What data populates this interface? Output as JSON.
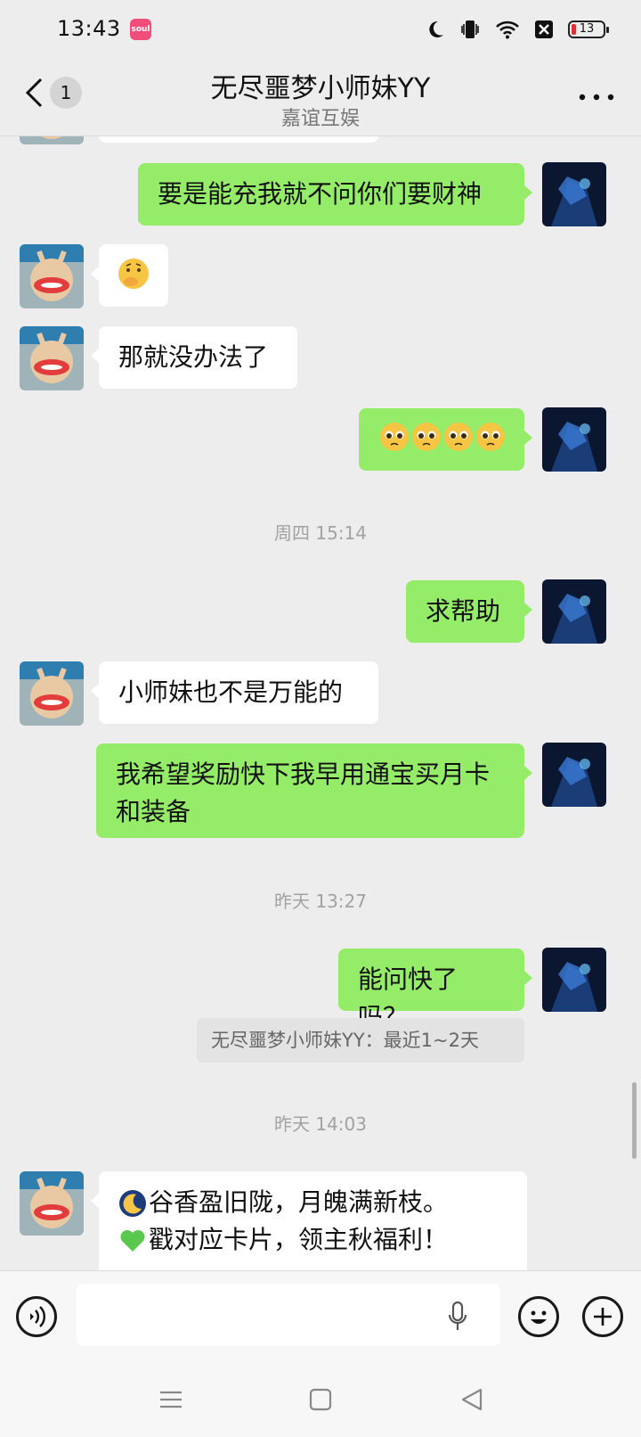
{
  "status_bar": {
    "time": "13:43",
    "app_icon": "soul-app-icon",
    "icons": [
      "moon-icon",
      "vibrate-icon",
      "wifi-icon",
      "close-box-icon",
      "battery-icon"
    ],
    "battery_level": "13",
    "battery_color": "#e0302f"
  },
  "header": {
    "back_icon": "chevron-left-icon",
    "unread_count": "1",
    "title": "无尽噩梦小师妹YY",
    "subtitle": "嘉谊互娱",
    "more_icon": "more-dots-icon"
  },
  "messages": [
    {
      "side": "out",
      "text": "要是能充我就不问你们要财神"
    },
    {
      "side": "in",
      "emoji": "thinking-face-emoji"
    },
    {
      "side": "in",
      "text": "那就没办法了"
    },
    {
      "side": "out",
      "emoji_count": 4,
      "emoji": "pleading-face-emoji"
    },
    {
      "side": "out",
      "text": "求帮助"
    },
    {
      "side": "in",
      "text": "小师妹也不是万能的"
    },
    {
      "side": "out",
      "text": "我希望奖励快下我早用通宝买月卡和装备"
    },
    {
      "side": "out",
      "text": "能问快了吗？"
    },
    {
      "side": "in",
      "text": "谷香盈旧陇，月魄满新枝。"
    }
  ],
  "timestamps": [
    "周四 15:14",
    "昨天 13:27",
    "昨天 14:03"
  ],
  "quote": "无尽噩梦小师妹YY：最近1~2天",
  "partial_line": "戳对应卡片，领主秋福利！",
  "input_bar": {
    "voice_icon": "voice-icon",
    "text_value": "",
    "mic_icon": "microphone-icon",
    "emoji_icon": "smiley-icon",
    "plus_icon": "plus-icon"
  },
  "nav_bar": [
    "menu-icon",
    "home-icon",
    "back-triangle-icon"
  ],
  "colors": {
    "background": "#ededed",
    "outgoing_bubble": "#95ec69",
    "incoming_bubble": "#ffffff"
  }
}
